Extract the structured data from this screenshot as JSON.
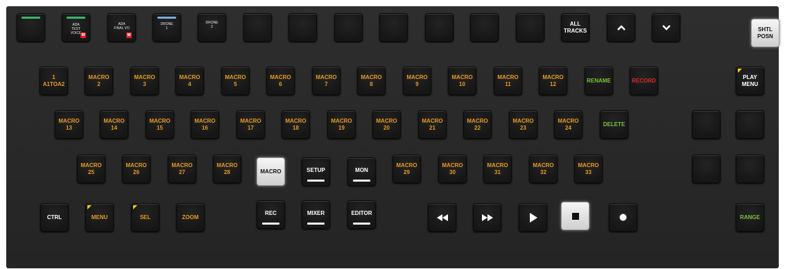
{
  "row1": {
    "ada_test_voice": "ADA\nTEST\nVOICE",
    "ada_final_vo": "ADA\nFINAL VO",
    "drone_1": "DRONE\n1",
    "drone_2": "DRONE\n2",
    "m_badge": "M",
    "all_tracks": "ALL\nTRACKS",
    "shtl_posn": "SHTL\nPOSN"
  },
  "row2": {
    "a1toa2": "1\nA1TOA2",
    "macros": [
      "MACRO\n2",
      "MACRO\n3",
      "MACRO\n4",
      "MACRO\n5",
      "MACRO\n6",
      "MACRO\n7",
      "MACRO\n8",
      "MACRO\n9",
      "MACRO\n10",
      "MACRO\n11",
      "MACRO\n12"
    ],
    "rename": "RENAME",
    "record": "RECORD",
    "play_menu": "PLAY\nMENU"
  },
  "row3": {
    "macros": [
      "MACRO\n13",
      "MACRO\n14",
      "MACRO\n15",
      "MACRO\n16",
      "MACRO\n17",
      "MACRO\n18",
      "MACRO\n19",
      "MACRO\n20",
      "MACRO\n21",
      "MACRO\n22",
      "MACRO\n23",
      "MACRO\n24"
    ],
    "delete": "DELETE"
  },
  "row4": {
    "macros_left": [
      "MACRO\n25",
      "MACRO\n26",
      "MACRO\n27",
      "MACRO\n28"
    ],
    "macro": "MACRO",
    "setup": "SETUP",
    "mon": "MON",
    "macros_right": [
      "MACRO\n29",
      "MACRO\n30",
      "MACRO\n31",
      "MACRO\n32",
      "MACRO\n33"
    ]
  },
  "row5": {
    "ctrl": "CTRL",
    "menu": "MENU",
    "sel": "SEL",
    "zoom": "ZOOM",
    "rec": "REC",
    "mixer": "MIXER",
    "editor": "EDITOR",
    "range": "RANGE"
  },
  "icons": [
    "chevron-up-icon",
    "chevron-down-icon",
    "rewind-icon",
    "fast-forward-icon",
    "play-icon",
    "stop-icon",
    "record-dot-icon"
  ],
  "colors": {
    "orange": "#e79a23",
    "green": "#7bc23a",
    "red": "#e0252b",
    "track_green": "#3fb26a",
    "track_blue": "#7ea9d6",
    "corner_yellow": "#f1d200"
  }
}
